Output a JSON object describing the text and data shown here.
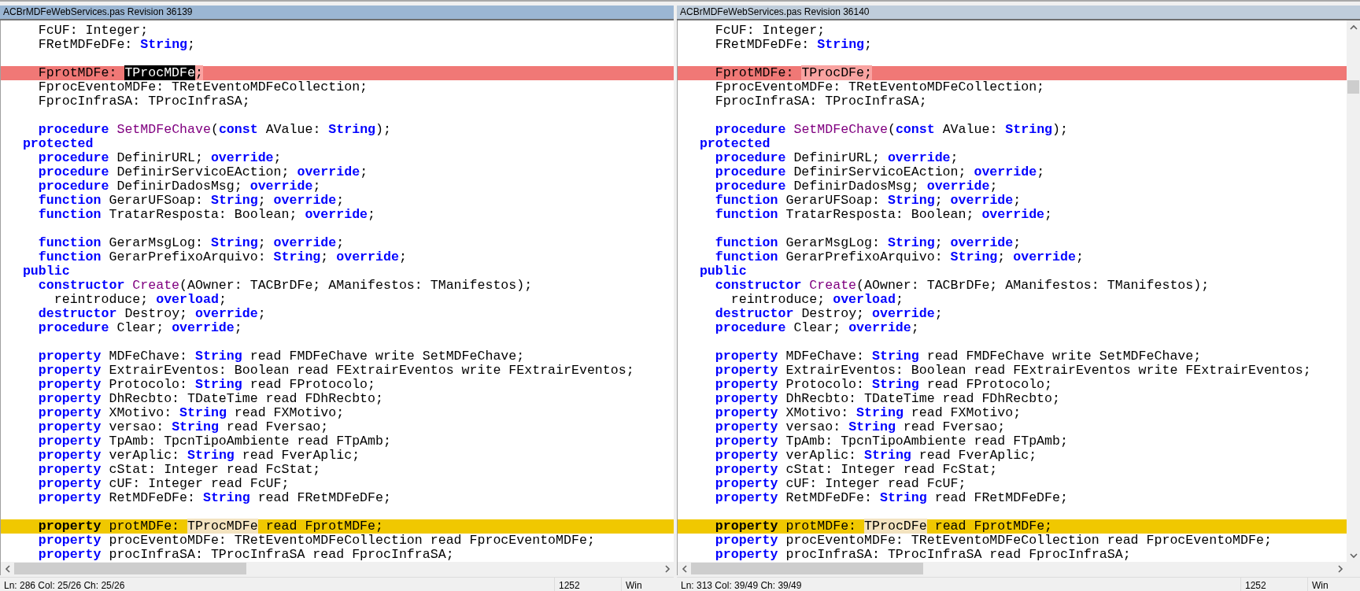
{
  "panes": [
    {
      "title": "ACBrMDFeWebServices.pas Revision 36139",
      "active": true,
      "lines": [
        {
          "kind": "normal",
          "tokens": [
            {
              "kind": "plain",
              "text": "    FcUF: Integer;"
            }
          ]
        },
        {
          "kind": "normal",
          "tokens": [
            {
              "kind": "plain",
              "text": "    FRetMDFeDFe: "
            },
            {
              "kind": "keyword",
              "text": "String"
            },
            {
              "kind": "plain",
              "text": ";"
            }
          ]
        },
        {
          "kind": "blank"
        },
        {
          "kind": "removed",
          "tokens": [
            {
              "kind": "plain",
              "text": "    FprotMDFe: "
            },
            {
              "kind": "selected",
              "text": "TProcMDFe"
            },
            {
              "kind": "changed",
              "text": ";"
            }
          ]
        },
        {
          "kind": "normal",
          "tokens": [
            {
              "kind": "plain",
              "text": "    FprocEventoMDFe: TRetEventoMDFeCollection;"
            }
          ]
        },
        {
          "kind": "normal",
          "tokens": [
            {
              "kind": "plain",
              "text": "    FprocInfraSA: TProcInfraSA;"
            }
          ]
        },
        {
          "kind": "blank"
        },
        {
          "kind": "normal",
          "tokens": [
            {
              "kind": "keyword",
              "text": "    procedure "
            },
            {
              "kind": "method",
              "text": "SetMDFeChave"
            },
            {
              "kind": "plain",
              "text": "("
            },
            {
              "kind": "keyword",
              "text": "const"
            },
            {
              "kind": "plain",
              "text": " AValue: "
            },
            {
              "kind": "keyword",
              "text": "String"
            },
            {
              "kind": "plain",
              "text": ");"
            }
          ]
        },
        {
          "kind": "normal",
          "tokens": [
            {
              "kind": "keyword",
              "text": "  protected"
            }
          ]
        },
        {
          "kind": "normal",
          "tokens": [
            {
              "kind": "keyword",
              "text": "    procedure"
            },
            {
              "kind": "plain",
              "text": " DefinirURL; "
            },
            {
              "kind": "keyword",
              "text": "override"
            },
            {
              "kind": "plain",
              "text": ";"
            }
          ]
        },
        {
          "kind": "normal",
          "tokens": [
            {
              "kind": "keyword",
              "text": "    procedure"
            },
            {
              "kind": "plain",
              "text": " DefinirServicoEAction; "
            },
            {
              "kind": "keyword",
              "text": "override"
            },
            {
              "kind": "plain",
              "text": ";"
            }
          ]
        },
        {
          "kind": "normal",
          "tokens": [
            {
              "kind": "keyword",
              "text": "    procedure"
            },
            {
              "kind": "plain",
              "text": " DefinirDadosMsg; "
            },
            {
              "kind": "keyword",
              "text": "override"
            },
            {
              "kind": "plain",
              "text": ";"
            }
          ]
        },
        {
          "kind": "normal",
          "tokens": [
            {
              "kind": "keyword",
              "text": "    function"
            },
            {
              "kind": "plain",
              "text": " GerarUFSoap: "
            },
            {
              "kind": "keyword",
              "text": "String"
            },
            {
              "kind": "plain",
              "text": "; "
            },
            {
              "kind": "keyword",
              "text": "override"
            },
            {
              "kind": "plain",
              "text": ";"
            }
          ]
        },
        {
          "kind": "normal",
          "tokens": [
            {
              "kind": "keyword",
              "text": "    function"
            },
            {
              "kind": "plain",
              "text": " TratarResposta: Boolean; "
            },
            {
              "kind": "keyword",
              "text": "override"
            },
            {
              "kind": "plain",
              "text": ";"
            }
          ]
        },
        {
          "kind": "blank"
        },
        {
          "kind": "normal",
          "tokens": [
            {
              "kind": "keyword",
              "text": "    function"
            },
            {
              "kind": "plain",
              "text": " GerarMsgLog: "
            },
            {
              "kind": "keyword",
              "text": "String"
            },
            {
              "kind": "plain",
              "text": "; "
            },
            {
              "kind": "keyword",
              "text": "override"
            },
            {
              "kind": "plain",
              "text": ";"
            }
          ]
        },
        {
          "kind": "normal",
          "tokens": [
            {
              "kind": "keyword",
              "text": "    function"
            },
            {
              "kind": "plain",
              "text": " GerarPrefixoArquivo: "
            },
            {
              "kind": "keyword",
              "text": "String"
            },
            {
              "kind": "plain",
              "text": "; "
            },
            {
              "kind": "keyword",
              "text": "override"
            },
            {
              "kind": "plain",
              "text": ";"
            }
          ]
        },
        {
          "kind": "normal",
          "tokens": [
            {
              "kind": "keyword",
              "text": "  public"
            }
          ]
        },
        {
          "kind": "normal",
          "tokens": [
            {
              "kind": "keyword",
              "text": "    constructor "
            },
            {
              "kind": "method",
              "text": "Create"
            },
            {
              "kind": "plain",
              "text": "(AOwner: TACBrDFe; AManifestos: TManifestos);"
            }
          ]
        },
        {
          "kind": "normal",
          "tokens": [
            {
              "kind": "plain",
              "text": "      reintroduce; "
            },
            {
              "kind": "keyword",
              "text": "overload"
            },
            {
              "kind": "plain",
              "text": ";"
            }
          ]
        },
        {
          "kind": "normal",
          "tokens": [
            {
              "kind": "keyword",
              "text": "    destructor"
            },
            {
              "kind": "plain",
              "text": " Destroy; "
            },
            {
              "kind": "keyword",
              "text": "override"
            },
            {
              "kind": "plain",
              "text": ";"
            }
          ]
        },
        {
          "kind": "normal",
          "tokens": [
            {
              "kind": "keyword",
              "text": "    procedure"
            },
            {
              "kind": "plain",
              "text": " Clear; "
            },
            {
              "kind": "keyword",
              "text": "override"
            },
            {
              "kind": "plain",
              "text": ";"
            }
          ]
        },
        {
          "kind": "blank"
        },
        {
          "kind": "normal",
          "tokens": [
            {
              "kind": "keyword",
              "text": "    property"
            },
            {
              "kind": "plain",
              "text": " MDFeChave: "
            },
            {
              "kind": "keyword",
              "text": "String"
            },
            {
              "kind": "plain",
              "text": " read FMDFeChave write SetMDFeChave;"
            }
          ]
        },
        {
          "kind": "normal",
          "tokens": [
            {
              "kind": "keyword",
              "text": "    property"
            },
            {
              "kind": "plain",
              "text": " ExtrairEventos: Boolean read FExtrairEventos write FExtrairEventos;"
            }
          ]
        },
        {
          "kind": "normal",
          "tokens": [
            {
              "kind": "keyword",
              "text": "    property"
            },
            {
              "kind": "plain",
              "text": " Protocolo: "
            },
            {
              "kind": "keyword",
              "text": "String"
            },
            {
              "kind": "plain",
              "text": " read FProtocolo;"
            }
          ]
        },
        {
          "kind": "normal",
          "tokens": [
            {
              "kind": "keyword",
              "text": "    property"
            },
            {
              "kind": "plain",
              "text": " DhRecbto: TDateTime read FDhRecbto;"
            }
          ]
        },
        {
          "kind": "normal",
          "tokens": [
            {
              "kind": "keyword",
              "text": "    property"
            },
            {
              "kind": "plain",
              "text": " XMotivo: "
            },
            {
              "kind": "keyword",
              "text": "String"
            },
            {
              "kind": "plain",
              "text": " read FXMotivo;"
            }
          ]
        },
        {
          "kind": "normal",
          "tokens": [
            {
              "kind": "keyword",
              "text": "    property"
            },
            {
              "kind": "plain",
              "text": " versao: "
            },
            {
              "kind": "keyword",
              "text": "String"
            },
            {
              "kind": "plain",
              "text": " read Fversao;"
            }
          ]
        },
        {
          "kind": "normal",
          "tokens": [
            {
              "kind": "keyword",
              "text": "    property"
            },
            {
              "kind": "plain",
              "text": " TpAmb: TpcnTipoAmbiente read FTpAmb;"
            }
          ]
        },
        {
          "kind": "normal",
          "tokens": [
            {
              "kind": "keyword",
              "text": "    property"
            },
            {
              "kind": "plain",
              "text": " verAplic: "
            },
            {
              "kind": "keyword",
              "text": "String"
            },
            {
              "kind": "plain",
              "text": " read FverAplic;"
            }
          ]
        },
        {
          "kind": "normal",
          "tokens": [
            {
              "kind": "keyword",
              "text": "    property"
            },
            {
              "kind": "plain",
              "text": " cStat: Integer read FcStat;"
            }
          ]
        },
        {
          "kind": "normal",
          "tokens": [
            {
              "kind": "keyword",
              "text": "    property"
            },
            {
              "kind": "plain",
              "text": " cUF: Integer read FcUF;"
            }
          ]
        },
        {
          "kind": "normal",
          "tokens": [
            {
              "kind": "keyword",
              "text": "    property"
            },
            {
              "kind": "plain",
              "text": " RetMDFeDFe: "
            },
            {
              "kind": "keyword",
              "text": "String"
            },
            {
              "kind": "plain",
              "text": " read FRetMDFeDFe;"
            }
          ]
        },
        {
          "kind": "blank"
        },
        {
          "kind": "edited",
          "tokens": [
            {
              "kind": "keyword",
              "text": "    property"
            },
            {
              "kind": "plain",
              "text": " protMDFe: "
            },
            {
              "kind": "changed",
              "text": "TProcMDFe"
            },
            {
              "kind": "plain",
              "text": " read FprotMDFe;"
            }
          ]
        },
        {
          "kind": "normal",
          "tokens": [
            {
              "kind": "keyword",
              "text": "    property"
            },
            {
              "kind": "plain",
              "text": " procEventoMDFe: TRetEventoMDFeCollection read FprocEventoMDFe;"
            }
          ]
        },
        {
          "kind": "normal",
          "tokens": [
            {
              "kind": "keyword",
              "text": "    property"
            },
            {
              "kind": "plain",
              "text": " procInfraSA: TProcInfraSA read FprocInfraSA;"
            }
          ]
        }
      ],
      "status": [
        "Ln: 286  Col: 25/26  Ch: 25/26",
        "1252",
        "Win"
      ]
    },
    {
      "title": "ACBrMDFeWebServices.pas Revision 36140",
      "active": false,
      "lines": [
        {
          "kind": "normal",
          "tokens": [
            {
              "kind": "plain",
              "text": "    FcUF: Integer;"
            }
          ]
        },
        {
          "kind": "normal",
          "tokens": [
            {
              "kind": "plain",
              "text": "    FRetMDFeDFe: "
            },
            {
              "kind": "keyword",
              "text": "String"
            },
            {
              "kind": "plain",
              "text": ";"
            }
          ]
        },
        {
          "kind": "blank"
        },
        {
          "kind": "added",
          "tokens": [
            {
              "kind": "plain",
              "text": "    FprotMDFe: "
            },
            {
              "kind": "changed",
              "text": "TProcDFe;"
            }
          ]
        },
        {
          "kind": "normal",
          "tokens": [
            {
              "kind": "plain",
              "text": "    FprocEventoMDFe: TRetEventoMDFeCollection;"
            }
          ]
        },
        {
          "kind": "normal",
          "tokens": [
            {
              "kind": "plain",
              "text": "    FprocInfraSA: TProcInfraSA;"
            }
          ]
        },
        {
          "kind": "blank"
        },
        {
          "kind": "normal",
          "tokens": [
            {
              "kind": "keyword",
              "text": "    procedure "
            },
            {
              "kind": "method",
              "text": "SetMDFeChave"
            },
            {
              "kind": "plain",
              "text": "("
            },
            {
              "kind": "keyword",
              "text": "const"
            },
            {
              "kind": "plain",
              "text": " AValue: "
            },
            {
              "kind": "keyword",
              "text": "String"
            },
            {
              "kind": "plain",
              "text": ");"
            }
          ]
        },
        {
          "kind": "normal",
          "tokens": [
            {
              "kind": "keyword",
              "text": "  protected"
            }
          ]
        },
        {
          "kind": "normal",
          "tokens": [
            {
              "kind": "keyword",
              "text": "    procedure"
            },
            {
              "kind": "plain",
              "text": " DefinirURL; "
            },
            {
              "kind": "keyword",
              "text": "override"
            },
            {
              "kind": "plain",
              "text": ";"
            }
          ]
        },
        {
          "kind": "normal",
          "tokens": [
            {
              "kind": "keyword",
              "text": "    procedure"
            },
            {
              "kind": "plain",
              "text": " DefinirServicoEAction; "
            },
            {
              "kind": "keyword",
              "text": "override"
            },
            {
              "kind": "plain",
              "text": ";"
            }
          ]
        },
        {
          "kind": "normal",
          "tokens": [
            {
              "kind": "keyword",
              "text": "    procedure"
            },
            {
              "kind": "plain",
              "text": " DefinirDadosMsg; "
            },
            {
              "kind": "keyword",
              "text": "override"
            },
            {
              "kind": "plain",
              "text": ";"
            }
          ]
        },
        {
          "kind": "normal",
          "tokens": [
            {
              "kind": "keyword",
              "text": "    function"
            },
            {
              "kind": "plain",
              "text": " GerarUFSoap: "
            },
            {
              "kind": "keyword",
              "text": "String"
            },
            {
              "kind": "plain",
              "text": "; "
            },
            {
              "kind": "keyword",
              "text": "override"
            },
            {
              "kind": "plain",
              "text": ";"
            }
          ]
        },
        {
          "kind": "normal",
          "tokens": [
            {
              "kind": "keyword",
              "text": "    function"
            },
            {
              "kind": "plain",
              "text": " TratarResposta: Boolean; "
            },
            {
              "kind": "keyword",
              "text": "override"
            },
            {
              "kind": "plain",
              "text": ";"
            }
          ]
        },
        {
          "kind": "blank"
        },
        {
          "kind": "normal",
          "tokens": [
            {
              "kind": "keyword",
              "text": "    function"
            },
            {
              "kind": "plain",
              "text": " GerarMsgLog: "
            },
            {
              "kind": "keyword",
              "text": "String"
            },
            {
              "kind": "plain",
              "text": "; "
            },
            {
              "kind": "keyword",
              "text": "override"
            },
            {
              "kind": "plain",
              "text": ";"
            }
          ]
        },
        {
          "kind": "normal",
          "tokens": [
            {
              "kind": "keyword",
              "text": "    function"
            },
            {
              "kind": "plain",
              "text": " GerarPrefixoArquivo: "
            },
            {
              "kind": "keyword",
              "text": "String"
            },
            {
              "kind": "plain",
              "text": "; "
            },
            {
              "kind": "keyword",
              "text": "override"
            },
            {
              "kind": "plain",
              "text": ";"
            }
          ]
        },
        {
          "kind": "normal",
          "tokens": [
            {
              "kind": "keyword",
              "text": "  public"
            }
          ]
        },
        {
          "kind": "normal",
          "tokens": [
            {
              "kind": "keyword",
              "text": "    constructor "
            },
            {
              "kind": "method",
              "text": "Create"
            },
            {
              "kind": "plain",
              "text": "(AOwner: TACBrDFe; AManifestos: TManifestos);"
            }
          ]
        },
        {
          "kind": "normal",
          "tokens": [
            {
              "kind": "plain",
              "text": "      reintroduce; "
            },
            {
              "kind": "keyword",
              "text": "overload"
            },
            {
              "kind": "plain",
              "text": ";"
            }
          ]
        },
        {
          "kind": "normal",
          "tokens": [
            {
              "kind": "keyword",
              "text": "    destructor"
            },
            {
              "kind": "plain",
              "text": " Destroy; "
            },
            {
              "kind": "keyword",
              "text": "override"
            },
            {
              "kind": "plain",
              "text": ";"
            }
          ]
        },
        {
          "kind": "normal",
          "tokens": [
            {
              "kind": "keyword",
              "text": "    procedure"
            },
            {
              "kind": "plain",
              "text": " Clear; "
            },
            {
              "kind": "keyword",
              "text": "override"
            },
            {
              "kind": "plain",
              "text": ";"
            }
          ]
        },
        {
          "kind": "blank"
        },
        {
          "kind": "normal",
          "tokens": [
            {
              "kind": "keyword",
              "text": "    property"
            },
            {
              "kind": "plain",
              "text": " MDFeChave: "
            },
            {
              "kind": "keyword",
              "text": "String"
            },
            {
              "kind": "plain",
              "text": " read FMDFeChave write SetMDFeChave;"
            }
          ]
        },
        {
          "kind": "normal",
          "tokens": [
            {
              "kind": "keyword",
              "text": "    property"
            },
            {
              "kind": "plain",
              "text": " ExtrairEventos: Boolean read FExtrairEventos write FExtrairEventos;"
            }
          ]
        },
        {
          "kind": "normal",
          "tokens": [
            {
              "kind": "keyword",
              "text": "    property"
            },
            {
              "kind": "plain",
              "text": " Protocolo: "
            },
            {
              "kind": "keyword",
              "text": "String"
            },
            {
              "kind": "plain",
              "text": " read FProtocolo;"
            }
          ]
        },
        {
          "kind": "normal",
          "tokens": [
            {
              "kind": "keyword",
              "text": "    property"
            },
            {
              "kind": "plain",
              "text": " DhRecbto: TDateTime read FDhRecbto;"
            }
          ]
        },
        {
          "kind": "normal",
          "tokens": [
            {
              "kind": "keyword",
              "text": "    property"
            },
            {
              "kind": "plain",
              "text": " XMotivo: "
            },
            {
              "kind": "keyword",
              "text": "String"
            },
            {
              "kind": "plain",
              "text": " read FXMotivo;"
            }
          ]
        },
        {
          "kind": "normal",
          "tokens": [
            {
              "kind": "keyword",
              "text": "    property"
            },
            {
              "kind": "plain",
              "text": " versao: "
            },
            {
              "kind": "keyword",
              "text": "String"
            },
            {
              "kind": "plain",
              "text": " read Fversao;"
            }
          ]
        },
        {
          "kind": "normal",
          "tokens": [
            {
              "kind": "keyword",
              "text": "    property"
            },
            {
              "kind": "plain",
              "text": " TpAmb: TpcnTipoAmbiente read FTpAmb;"
            }
          ]
        },
        {
          "kind": "normal",
          "tokens": [
            {
              "kind": "keyword",
              "text": "    property"
            },
            {
              "kind": "plain",
              "text": " verAplic: "
            },
            {
              "kind": "keyword",
              "text": "String"
            },
            {
              "kind": "plain",
              "text": " read FverAplic;"
            }
          ]
        },
        {
          "kind": "normal",
          "tokens": [
            {
              "kind": "keyword",
              "text": "    property"
            },
            {
              "kind": "plain",
              "text": " cStat: Integer read FcStat;"
            }
          ]
        },
        {
          "kind": "normal",
          "tokens": [
            {
              "kind": "keyword",
              "text": "    property"
            },
            {
              "kind": "plain",
              "text": " cUF: Integer read FcUF;"
            }
          ]
        },
        {
          "kind": "normal",
          "tokens": [
            {
              "kind": "keyword",
              "text": "    property"
            },
            {
              "kind": "plain",
              "text": " RetMDFeDFe: "
            },
            {
              "kind": "keyword",
              "text": "String"
            },
            {
              "kind": "plain",
              "text": " read FRetMDFeDFe;"
            }
          ]
        },
        {
          "kind": "blank"
        },
        {
          "kind": "edited",
          "tokens": [
            {
              "kind": "keyword",
              "text": "    property"
            },
            {
              "kind": "plain",
              "text": " protMDFe: "
            },
            {
              "kind": "changed",
              "text": "TProcDFe"
            },
            {
              "kind": "plain",
              "text": " read FprotMDFe;"
            }
          ]
        },
        {
          "kind": "normal",
          "tokens": [
            {
              "kind": "keyword",
              "text": "    property"
            },
            {
              "kind": "plain",
              "text": " procEventoMDFe: TRetEventoMDFeCollection read FprocEventoMDFe;"
            }
          ]
        },
        {
          "kind": "normal",
          "tokens": [
            {
              "kind": "keyword",
              "text": "    property"
            },
            {
              "kind": "plain",
              "text": " procInfraSA: TProcInfraSA read FprocInfraSA;"
            }
          ]
        }
      ],
      "status": [
        "Ln: 313  Col: 39/49  Ch: 39/49",
        "1252",
        "Win"
      ]
    }
  ]
}
